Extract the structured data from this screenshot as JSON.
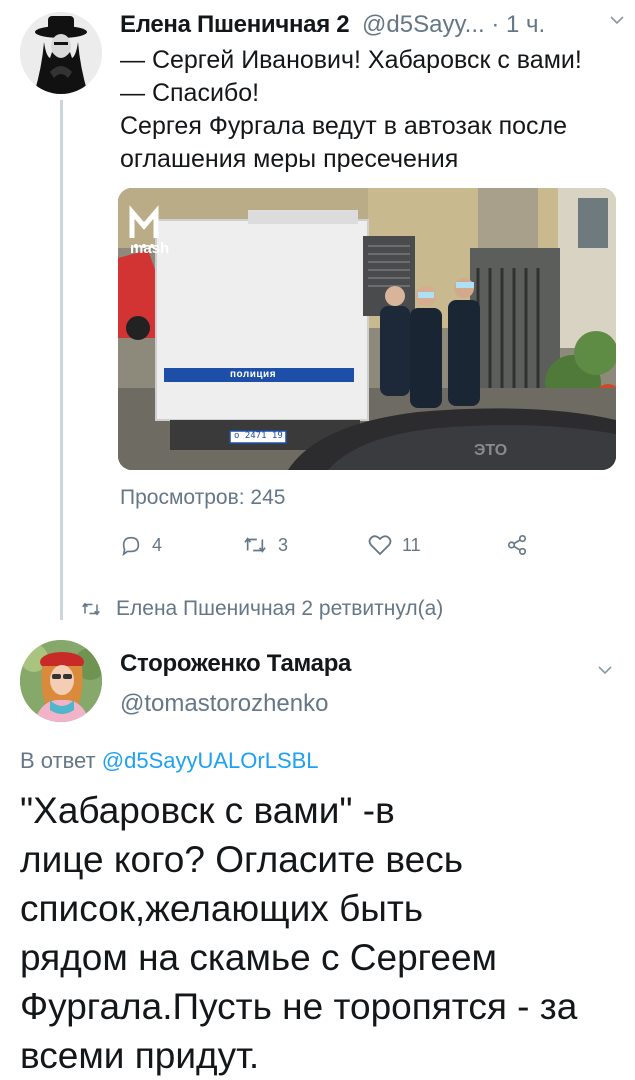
{
  "tweet1": {
    "author_name": "Елена Пшеничная 2",
    "handle": "@d5Sayy...",
    "time": "· 1 ч.",
    "lines": [
      "— Сергей Иванович! Хабаровск с вами!",
      "— Спасибо!",
      "Сергея Фургала ведут в автозак после",
      "оглашения меры пресечения"
    ],
    "media": {
      "watermark": "mash",
      "van_label": "полиция",
      "plate": "о 2471 19",
      "car_text": "ЭТО"
    },
    "views": "Просмотров: 245",
    "actions": {
      "replies": "4",
      "retweets": "3",
      "likes": "11"
    },
    "retweet_context": "Елена Пшеничная 2 ретвитнул(а)"
  },
  "tweet2": {
    "author_name": "Стороженко Тамара",
    "handle": "@tomastorozhenko",
    "reply_label": "В ответ",
    "reply_mention": "@d5SayyUALOrLSBL",
    "lines": [
      "\"Хабаровск с вами\" -в",
      "лице кого? Огласите весь",
      "список,желающих быть",
      "рядом на скамье с Сергеем",
      "Фургала.Пусть не торопятся - за",
      "всеми придут."
    ]
  },
  "colors": {
    "text": "#14171a",
    "secondary": "#657786",
    "link": "#1da1f2",
    "thread_line": "#ccd6dd"
  },
  "icons": [
    "reply-icon",
    "retweet-icon",
    "like-icon",
    "share-icon",
    "chevron-down-icon"
  ]
}
